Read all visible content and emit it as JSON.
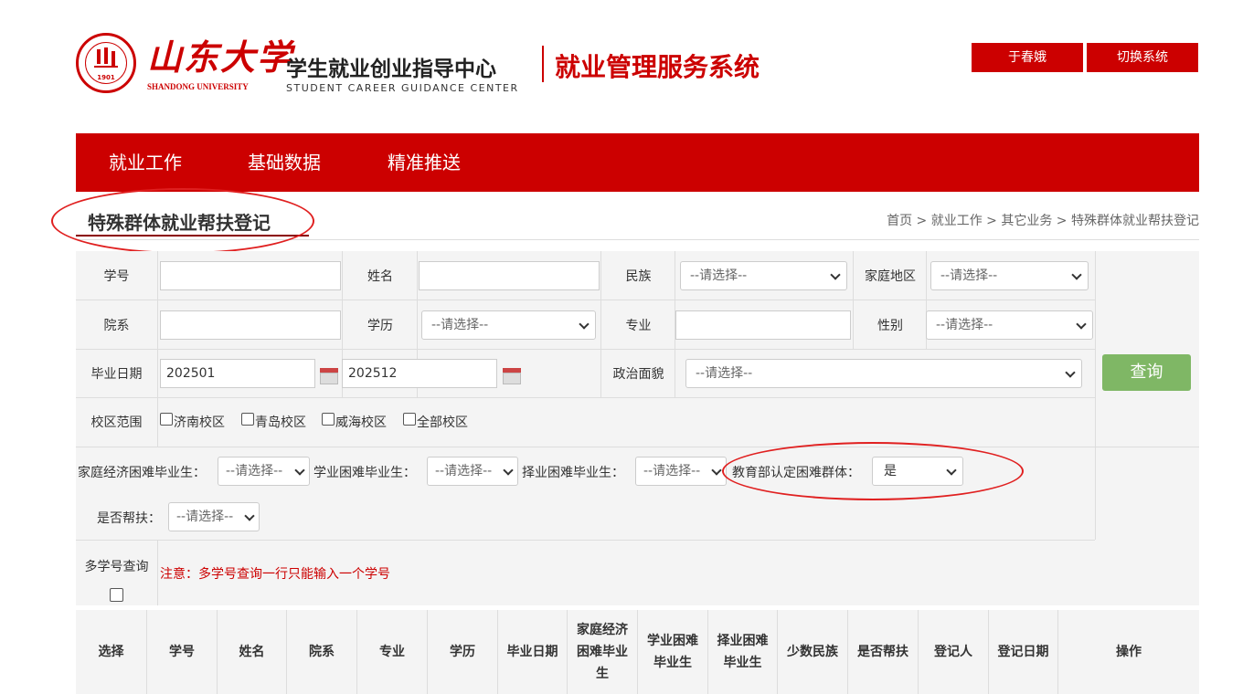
{
  "header": {
    "university_cn": "山东大学",
    "university_en": "SHANDONG UNIVERSITY",
    "seal_year": "1901",
    "center_cn": "学生就业创业指导中心",
    "center_en": "STUDENT  CAREER  GUIDANCE  CENTER",
    "system_title": "就业管理服务系统",
    "user_button": "于春娥",
    "switch_button": "切换系统"
  },
  "nav": {
    "items": [
      "就业工作",
      "基础数据",
      "精准推送"
    ]
  },
  "page": {
    "title": "特殊群体就业帮扶登记",
    "breadcrumb": "首页 > 就业工作 > 其它业务 > 特殊群体就业帮扶登记"
  },
  "form": {
    "labels": {
      "student_id": "学号",
      "name": "姓名",
      "ethnicity": "民族",
      "home_region": "家庭地区",
      "department": "院系",
      "education": "学历",
      "major": "专业",
      "gender": "性别",
      "graduation_date": "毕业日期",
      "political_status": "政治面貌",
      "campus_range": "校区范围",
      "econ_difficulty": "家庭经济困难毕业生：",
      "study_difficulty": "学业困难毕业生：",
      "job_difficulty": "择业困难毕业生：",
      "moe_group": "教育部认定困难群体：",
      "assisted": "是否帮扶：",
      "multi_id": "多学号查询"
    },
    "placeholder_option": "--请选择--",
    "graduation_from": "202501",
    "graduation_to": "202512",
    "moe_group_value": "是",
    "campuses": [
      "济南校区",
      "青岛校区",
      "威海校区",
      "全部校区"
    ],
    "query_button": "查询",
    "notice": "注意：多学号查询一行只能输入一个学号"
  },
  "table": {
    "headers": [
      "选择",
      "学号",
      "姓名",
      "院系",
      "专业",
      "学历",
      "毕业日期",
      "家庭经济\n困难毕业\n生",
      "学业困难\n毕业生",
      "择业困难\n毕业生",
      "少数民族",
      "是否帮扶",
      "登记人",
      "登记日期",
      "操作"
    ]
  },
  "colors": {
    "brand_red": "#cc0000",
    "query_green": "#7fb765",
    "annotation_red": "#e02020"
  }
}
